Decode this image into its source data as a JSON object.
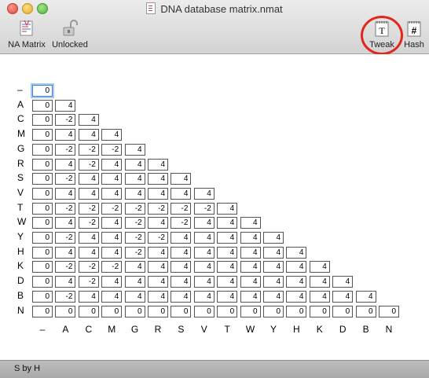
{
  "window": {
    "title": "DNA database matrix.nmat"
  },
  "toolbar": {
    "left": [
      {
        "label": "NA Matrix",
        "icon": "na-matrix-icon"
      },
      {
        "label": "Unlocked",
        "icon": "unlocked-padlock-icon"
      }
    ],
    "right": [
      {
        "label": "Tweak",
        "icon": "tweak-notepad-icon",
        "highlighted": true
      },
      {
        "label": "Hash",
        "icon": "hash-notepad-icon"
      }
    ],
    "highlight_color": "#e3261b"
  },
  "matrix": {
    "row_labels": [
      "–",
      "A",
      "C",
      "M",
      "G",
      "R",
      "S",
      "V",
      "T",
      "W",
      "Y",
      "H",
      "K",
      "D",
      "B",
      "N"
    ],
    "col_labels": [
      "–",
      "A",
      "C",
      "M",
      "G",
      "R",
      "S",
      "V",
      "T",
      "W",
      "Y",
      "H",
      "K",
      "D",
      "B",
      "N"
    ],
    "selected_cell": [
      0,
      0
    ],
    "rows": [
      [
        "0"
      ],
      [
        "0",
        "4"
      ],
      [
        "0",
        "-2",
        "4"
      ],
      [
        "0",
        "4",
        "4",
        "4"
      ],
      [
        "0",
        "-2",
        "-2",
        "-2",
        "4"
      ],
      [
        "0",
        "4",
        "-2",
        "4",
        "4",
        "4"
      ],
      [
        "0",
        "-2",
        "4",
        "4",
        "4",
        "4",
        "4"
      ],
      [
        "0",
        "4",
        "4",
        "4",
        "4",
        "4",
        "4",
        "4"
      ],
      [
        "0",
        "-2",
        "-2",
        "-2",
        "-2",
        "-2",
        "-2",
        "-2",
        "4"
      ],
      [
        "0",
        "4",
        "-2",
        "4",
        "-2",
        "4",
        "-2",
        "4",
        "4",
        "4"
      ],
      [
        "0",
        "-2",
        "4",
        "4",
        "-2",
        "-2",
        "4",
        "4",
        "4",
        "4",
        "4"
      ],
      [
        "0",
        "4",
        "4",
        "4",
        "-2",
        "4",
        "4",
        "4",
        "4",
        "4",
        "4",
        "4"
      ],
      [
        "0",
        "-2",
        "-2",
        "-2",
        "4",
        "4",
        "4",
        "4",
        "4",
        "4",
        "4",
        "4",
        "4"
      ],
      [
        "0",
        "4",
        "-2",
        "4",
        "4",
        "4",
        "4",
        "4",
        "4",
        "4",
        "4",
        "4",
        "4",
        "4"
      ],
      [
        "0",
        "-2",
        "4",
        "4",
        "4",
        "4",
        "4",
        "4",
        "4",
        "4",
        "4",
        "4",
        "4",
        "4",
        "4"
      ],
      [
        "0",
        "0",
        "0",
        "0",
        "0",
        "0",
        "0",
        "0",
        "0",
        "0",
        "0",
        "0",
        "0",
        "0",
        "0",
        "0"
      ]
    ]
  },
  "status": {
    "text": "S by H"
  }
}
